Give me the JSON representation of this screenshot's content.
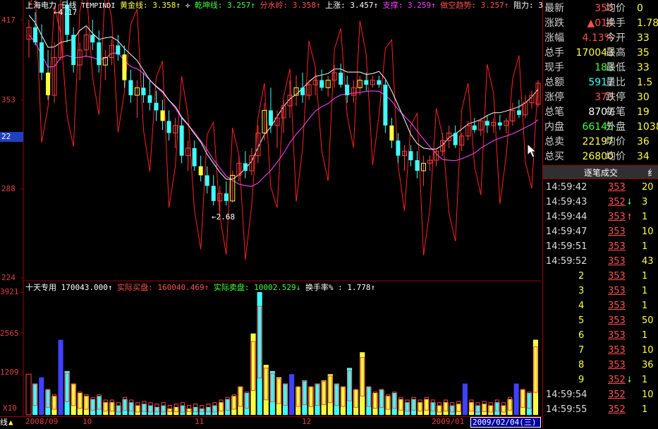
{
  "header": {
    "stock_name": "上海电力",
    "period": "日线",
    "indicator_name": "TEMPINDI",
    "gold_label": "黄金线: 3.358↑",
    "qiankun_label": "乾坤线: 3.257↑",
    "fenshui_label": "分水岭: 3.358↑",
    "shangzhang_label": "上涨: 3.457↑",
    "zhicheng_label": "支撑: 3.259↑",
    "zuokong_label": "做空趋势: 3.257↑",
    "zuli_label": "阻力: 3"
  },
  "sub_header": {
    "label": "十天专用",
    "vol": "170043.000↑",
    "buy": "实际买盘: 160040.469↑",
    "sell": "实际卖盘: 10002.529↓",
    "turnover": "换手率% : 1.778↑"
  },
  "price_axis": [
    "417",
    "353",
    "22",
    "288",
    "224"
  ],
  "vol_axis": [
    "3921",
    "2565",
    "1209",
    "X10"
  ],
  "annotations": {
    "high": "4.17",
    "low": "2.68"
  },
  "date_axis": {
    "left_stub": "线",
    "labels": [
      "2008/09",
      "10",
      "11",
      "12",
      "2009/01"
    ],
    "current": "2009/02/04(三)"
  },
  "quote": [
    {
      "k": "最新",
      "v": "353",
      "vc": "red",
      "k2": "均价",
      "v2": "0"
    },
    {
      "k": "涨跌",
      "v": "▲014",
      "vc": "red",
      "k2": "换手",
      "v2": "1.78"
    },
    {
      "k": "涨幅",
      "v": "4.13%",
      "vc": "red",
      "k2": "今开",
      "v2": "33"
    },
    {
      "k": "总手",
      "v": "170043",
      "vc": "yellow",
      "k2": "最高",
      "v2": "35"
    },
    {
      "k": "现手",
      "v": "183",
      "vc": "green",
      "k2": "最低",
      "v2": "33"
    },
    {
      "k": "总额",
      "v": "5917",
      "vc": "cyan",
      "k2": "量比",
      "v2": "1.5"
    },
    {
      "k": "涨停",
      "v": "373",
      "vc": "red",
      "k2": "跌停",
      "v2": "30"
    },
    {
      "k": "总笔",
      "v": "8707",
      "vc": "white",
      "k2": "每笔",
      "v2": "19"
    },
    {
      "k": "内盘",
      "v": "66145",
      "vc": "green",
      "k2": "外盘",
      "v2": "10389"
    },
    {
      "k": "总卖",
      "v": "22197",
      "vc": "yellow",
      "k2": "均价",
      "v2": "36"
    },
    {
      "k": "总买",
      "v": "26800",
      "vc": "yellow",
      "k2": "均价",
      "v2": "34"
    }
  ],
  "ticks_title": "逐笔成交",
  "ticks_tab2": "纟",
  "ticks": [
    {
      "t": "14:59:42",
      "p": "353",
      "a": "",
      "vol": "20"
    },
    {
      "t": "14:59:43",
      "p": "352",
      "a": "down",
      "vol": "3"
    },
    {
      "t": "14:59:44",
      "p": "353",
      "a": "up",
      "vol": "1"
    },
    {
      "t": "14:59:47",
      "p": "353",
      "a": "",
      "vol": "10"
    },
    {
      "t": "14:59:51",
      "p": "353",
      "a": "",
      "vol": "1"
    },
    {
      "t": "14:59:52",
      "p": "353",
      "a": "",
      "vol": "43"
    },
    {
      "t": "2",
      "p": "353",
      "a": "",
      "vol": "1"
    },
    {
      "t": "3",
      "p": "353",
      "a": "",
      "vol": "1"
    },
    {
      "t": "4",
      "p": "353",
      "a": "",
      "vol": "1"
    },
    {
      "t": "5",
      "p": "353",
      "a": "",
      "vol": "50"
    },
    {
      "t": "6",
      "p": "353",
      "a": "",
      "vol": "1"
    },
    {
      "t": "7",
      "p": "353",
      "a": "",
      "vol": "10"
    },
    {
      "t": "8",
      "p": "353",
      "a": "",
      "vol": "36"
    },
    {
      "t": "9",
      "p": "352",
      "a": "down",
      "vol": "1"
    },
    {
      "t": "14:59:54",
      "p": "352",
      "a": "",
      "vol": "10"
    },
    {
      "t": "14:59:55",
      "p": "352",
      "a": "",
      "vol": "1"
    }
  ],
  "colors": {
    "up": "#ff4040",
    "down": "#40ffff",
    "gold": "#ffff40",
    "white_line": "#ffffff",
    "magenta_line": "#e040e0",
    "red_line": "#ff2020",
    "grid": "#a00000",
    "vol_blue": "#4040ff"
  },
  "candles": [
    {
      "o": 3.82,
      "h": 3.95,
      "l": 3.7,
      "c": 3.9
    },
    {
      "o": 3.9,
      "h": 4.0,
      "l": 3.78,
      "c": 3.8
    },
    {
      "o": 3.8,
      "h": 3.92,
      "l": 3.55,
      "c": 3.6
    },
    {
      "o": 3.6,
      "h": 3.75,
      "l": 3.42,
      "c": 3.45
    },
    {
      "o": 3.45,
      "h": 3.8,
      "l": 3.4,
      "c": 3.7
    },
    {
      "o": 3.7,
      "h": 4.17,
      "l": 3.68,
      "c": 4.05
    },
    {
      "o": 4.05,
      "h": 4.1,
      "l": 3.8,
      "c": 3.85
    },
    {
      "o": 3.85,
      "h": 3.9,
      "l": 3.6,
      "c": 3.65
    },
    {
      "o": 3.65,
      "h": 3.8,
      "l": 3.55,
      "c": 3.75
    },
    {
      "o": 3.75,
      "h": 3.9,
      "l": 3.7,
      "c": 3.85
    },
    {
      "o": 3.85,
      "h": 3.95,
      "l": 3.75,
      "c": 3.8
    },
    {
      "o": 3.8,
      "h": 3.88,
      "l": 3.6,
      "c": 3.65
    },
    {
      "o": 3.65,
      "h": 3.75,
      "l": 3.55,
      "c": 3.7
    },
    {
      "o": 3.7,
      "h": 3.82,
      "l": 3.65,
      "c": 3.78
    },
    {
      "o": 3.78,
      "h": 3.85,
      "l": 3.68,
      "c": 3.72
    },
    {
      "o": 3.72,
      "h": 3.78,
      "l": 3.5,
      "c": 3.55
    },
    {
      "o": 3.55,
      "h": 3.62,
      "l": 3.4,
      "c": 3.45
    },
    {
      "o": 3.45,
      "h": 3.55,
      "l": 3.3,
      "c": 3.5
    },
    {
      "o": 3.5,
      "h": 3.6,
      "l": 3.4,
      "c": 3.45
    },
    {
      "o": 3.45,
      "h": 3.55,
      "l": 3.35,
      "c": 3.4
    },
    {
      "o": 3.4,
      "h": 3.48,
      "l": 3.28,
      "c": 3.35
    },
    {
      "o": 3.35,
      "h": 3.42,
      "l": 3.22,
      "c": 3.28
    },
    {
      "o": 3.28,
      "h": 3.35,
      "l": 3.15,
      "c": 3.2
    },
    {
      "o": 3.2,
      "h": 3.3,
      "l": 3.1,
      "c": 3.25
    },
    {
      "o": 3.25,
      "h": 3.3,
      "l": 3.0,
      "c": 3.05
    },
    {
      "o": 3.05,
      "h": 3.15,
      "l": 2.95,
      "c": 3.1
    },
    {
      "o": 3.1,
      "h": 3.15,
      "l": 2.95,
      "c": 2.98
    },
    {
      "o": 2.98,
      "h": 3.05,
      "l": 2.88,
      "c": 2.92
    },
    {
      "o": 2.92,
      "h": 2.98,
      "l": 2.8,
      "c": 2.85
    },
    {
      "o": 2.85,
      "h": 2.92,
      "l": 2.72,
      "c": 2.75
    },
    {
      "o": 2.75,
      "h": 2.85,
      "l": 2.68,
      "c": 2.8
    },
    {
      "o": 2.8,
      "h": 2.88,
      "l": 2.72,
      "c": 2.75
    },
    {
      "o": 2.75,
      "h": 2.95,
      "l": 2.74,
      "c": 2.92
    },
    {
      "o": 2.92,
      "h": 3.05,
      "l": 2.88,
      "c": 3.0
    },
    {
      "o": 3.0,
      "h": 3.08,
      "l": 2.9,
      "c": 2.95
    },
    {
      "o": 2.95,
      "h": 3.1,
      "l": 2.92,
      "c": 3.05
    },
    {
      "o": 3.05,
      "h": 3.25,
      "l": 3.0,
      "c": 3.2
    },
    {
      "o": 3.2,
      "h": 3.4,
      "l": 3.15,
      "c": 3.35
    },
    {
      "o": 3.35,
      "h": 3.5,
      "l": 3.2,
      "c": 3.25
    },
    {
      "o": 3.25,
      "h": 3.35,
      "l": 3.1,
      "c": 3.3
    },
    {
      "o": 3.3,
      "h": 3.42,
      "l": 3.2,
      "c": 3.38
    },
    {
      "o": 3.38,
      "h": 3.55,
      "l": 3.3,
      "c": 3.45
    },
    {
      "o": 3.45,
      "h": 3.58,
      "l": 3.38,
      "c": 3.5
    },
    {
      "o": 3.5,
      "h": 3.6,
      "l": 3.4,
      "c": 3.45
    },
    {
      "o": 3.45,
      "h": 3.55,
      "l": 3.42,
      "c": 3.52
    },
    {
      "o": 3.52,
      "h": 3.6,
      "l": 3.45,
      "c": 3.55
    },
    {
      "o": 3.55,
      "h": 3.62,
      "l": 3.48,
      "c": 3.5
    },
    {
      "o": 3.5,
      "h": 3.58,
      "l": 3.44,
      "c": 3.55
    },
    {
      "o": 3.55,
      "h": 3.65,
      "l": 3.5,
      "c": 3.6
    },
    {
      "o": 3.6,
      "h": 3.66,
      "l": 3.5,
      "c": 3.52
    },
    {
      "o": 3.52,
      "h": 3.58,
      "l": 3.4,
      "c": 3.45
    },
    {
      "o": 3.45,
      "h": 3.55,
      "l": 3.4,
      "c": 3.5
    },
    {
      "o": 3.5,
      "h": 3.58,
      "l": 3.45,
      "c": 3.55
    },
    {
      "o": 3.55,
      "h": 3.6,
      "l": 3.48,
      "c": 3.52
    },
    {
      "o": 3.52,
      "h": 3.58,
      "l": 3.5,
      "c": 3.55
    },
    {
      "o": 3.55,
      "h": 3.58,
      "l": 3.5,
      "c": 3.52
    },
    {
      "o": 3.52,
      "h": 3.55,
      "l": 3.2,
      "c": 3.25
    },
    {
      "o": 3.25,
      "h": 3.3,
      "l": 3.1,
      "c": 3.15
    },
    {
      "o": 3.15,
      "h": 3.2,
      "l": 3.0,
      "c": 3.05
    },
    {
      "o": 3.05,
      "h": 3.12,
      "l": 2.95,
      "c": 3.08
    },
    {
      "o": 3.08,
      "h": 3.12,
      "l": 2.98,
      "c": 3.02
    },
    {
      "o": 3.02,
      "h": 3.08,
      "l": 2.9,
      "c": 2.95
    },
    {
      "o": 2.95,
      "h": 3.05,
      "l": 2.85,
      "c": 3.0
    },
    {
      "o": 3.0,
      "h": 3.05,
      "l": 2.95,
      "c": 3.02
    },
    {
      "o": 3.02,
      "h": 3.1,
      "l": 2.98,
      "c": 3.08
    },
    {
      "o": 3.08,
      "h": 3.2,
      "l": 3.05,
      "c": 3.15
    },
    {
      "o": 3.15,
      "h": 3.25,
      "l": 3.1,
      "c": 3.2
    },
    {
      "o": 3.2,
      "h": 3.25,
      "l": 3.1,
      "c": 3.12
    },
    {
      "o": 3.12,
      "h": 3.2,
      "l": 3.08,
      "c": 3.18
    },
    {
      "o": 3.18,
      "h": 3.28,
      "l": 3.15,
      "c": 3.25
    },
    {
      "o": 3.25,
      "h": 3.3,
      "l": 3.2,
      "c": 3.22
    },
    {
      "o": 3.22,
      "h": 3.3,
      "l": 3.18,
      "c": 3.28
    },
    {
      "o": 3.28,
      "h": 3.32,
      "l": 3.2,
      "c": 3.25
    },
    {
      "o": 3.25,
      "h": 3.3,
      "l": 3.2,
      "c": 3.27
    },
    {
      "o": 3.27,
      "h": 3.32,
      "l": 3.22,
      "c": 3.25
    },
    {
      "o": 3.25,
      "h": 3.3,
      "l": 3.2,
      "c": 3.28
    },
    {
      "o": 3.28,
      "h": 3.4,
      "l": 3.25,
      "c": 3.35
    },
    {
      "o": 3.35,
      "h": 3.42,
      "l": 3.3,
      "c": 3.32
    },
    {
      "o": 3.32,
      "h": 3.45,
      "l": 3.3,
      "c": 3.4
    },
    {
      "o": 3.4,
      "h": 3.48,
      "l": 3.36,
      "c": 3.45
    },
    {
      "o": 3.39,
      "h": 3.55,
      "l": 3.37,
      "c": 3.53
    }
  ],
  "vol_bars": [
    {
      "v": 1300,
      "t": "up_hollow"
    },
    {
      "v": 1000,
      "t": "down"
    },
    {
      "v": 1200,
      "t": "blue"
    },
    {
      "v": 800,
      "t": "down"
    },
    {
      "v": 600,
      "t": "gold"
    },
    {
      "v": 2400,
      "t": "blue"
    },
    {
      "v": 1400,
      "t": "down"
    },
    {
      "v": 1000,
      "t": "gold"
    },
    {
      "v": 700,
      "t": "gold"
    },
    {
      "v": 600,
      "t": "gold"
    },
    {
      "v": 500,
      "t": "down"
    },
    {
      "v": 600,
      "t": "down"
    },
    {
      "v": 400,
      "t": "gold"
    },
    {
      "v": 400,
      "t": "gold"
    },
    {
      "v": 300,
      "t": "down"
    },
    {
      "v": 500,
      "t": "down"
    },
    {
      "v": 400,
      "t": "down"
    },
    {
      "v": 300,
      "t": "gold"
    },
    {
      "v": 350,
      "t": "down"
    },
    {
      "v": 300,
      "t": "down"
    },
    {
      "v": 250,
      "t": "down"
    },
    {
      "v": 300,
      "t": "down"
    },
    {
      "v": 200,
      "t": "gold"
    },
    {
      "v": 250,
      "t": "gold"
    },
    {
      "v": 300,
      "t": "down"
    },
    {
      "v": 200,
      "t": "gold"
    },
    {
      "v": 250,
      "t": "down"
    },
    {
      "v": 200,
      "t": "down"
    },
    {
      "v": 250,
      "t": "down"
    },
    {
      "v": 300,
      "t": "down"
    },
    {
      "v": 400,
      "t": "gold"
    },
    {
      "v": 500,
      "t": "down"
    },
    {
      "v": 600,
      "t": "gold"
    },
    {
      "v": 900,
      "t": "gold"
    },
    {
      "v": 700,
      "t": "down"
    },
    {
      "v": 2600,
      "t": "gold"
    },
    {
      "v": 3921,
      "t": "down"
    },
    {
      "v": 1600,
      "t": "gold"
    },
    {
      "v": 1400,
      "t": "down"
    },
    {
      "v": 1200,
      "t": "gold"
    },
    {
      "v": 1000,
      "t": "down"
    },
    {
      "v": 1300,
      "t": "blue"
    },
    {
      "v": 900,
      "t": "gold"
    },
    {
      "v": 1100,
      "t": "down"
    },
    {
      "v": 900,
      "t": "gold"
    },
    {
      "v": 1000,
      "t": "down"
    },
    {
      "v": 1100,
      "t": "gold"
    },
    {
      "v": 1300,
      "t": "gold"
    },
    {
      "v": 1000,
      "t": "down"
    },
    {
      "v": 900,
      "t": "gold"
    },
    {
      "v": 1500,
      "t": "down"
    },
    {
      "v": 800,
      "t": "gold"
    },
    {
      "v": 2000,
      "t": "gold"
    },
    {
      "v": 900,
      "t": "down"
    },
    {
      "v": 700,
      "t": "gold"
    },
    {
      "v": 800,
      "t": "down"
    },
    {
      "v": 600,
      "t": "gold"
    },
    {
      "v": 700,
      "t": "down"
    },
    {
      "v": 500,
      "t": "gold"
    },
    {
      "v": 400,
      "t": "down"
    },
    {
      "v": 500,
      "t": "down"
    },
    {
      "v": 400,
      "t": "gold"
    },
    {
      "v": 500,
      "t": "gold"
    },
    {
      "v": 400,
      "t": "down"
    },
    {
      "v": 300,
      "t": "gold"
    },
    {
      "v": 400,
      "t": "gold"
    },
    {
      "v": 300,
      "t": "down"
    },
    {
      "v": 350,
      "t": "gold"
    },
    {
      "v": 1000,
      "t": "blue"
    },
    {
      "v": 400,
      "t": "gold"
    },
    {
      "v": 300,
      "t": "down"
    },
    {
      "v": 350,
      "t": "gold"
    },
    {
      "v": 300,
      "t": "gold"
    },
    {
      "v": 400,
      "t": "down"
    },
    {
      "v": 300,
      "t": "gold"
    },
    {
      "v": 500,
      "t": "gold"
    },
    {
      "v": 1000,
      "t": "blue"
    },
    {
      "v": 800,
      "t": "gold"
    },
    {
      "v": 700,
      "t": "down"
    },
    {
      "v": 2400,
      "t": "gold"
    }
  ]
}
